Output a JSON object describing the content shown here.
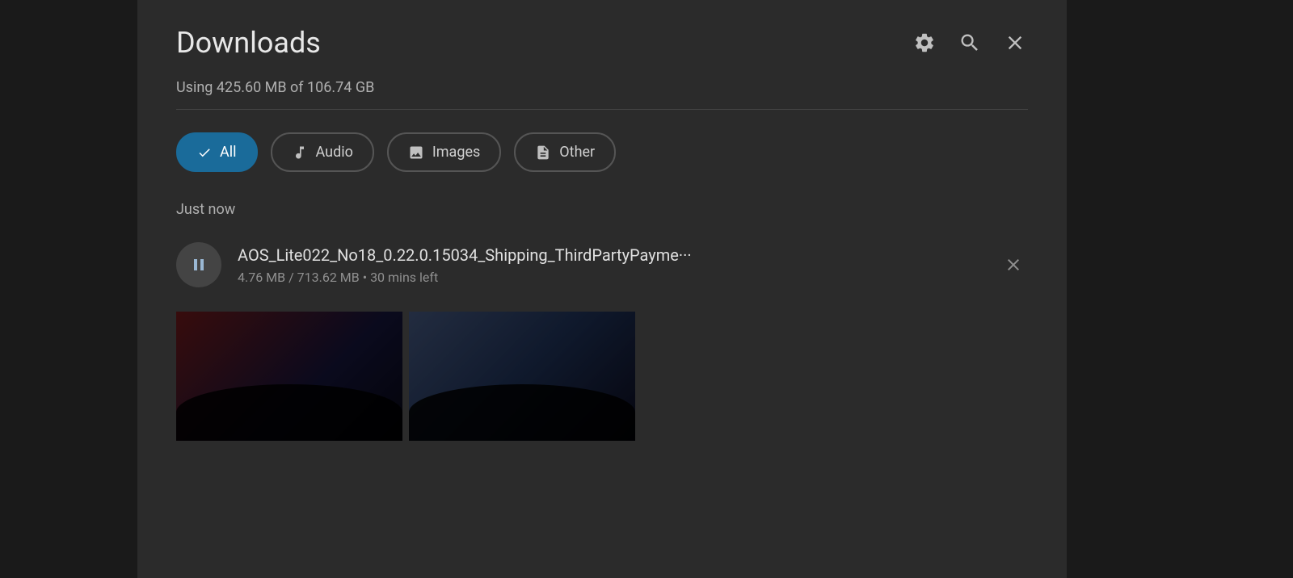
{
  "header": {
    "title": "Downloads",
    "settings_icon": "gear",
    "search_icon": "search",
    "close_icon": "close"
  },
  "storage": {
    "label": "Using 425.60 MB of 106.74 GB"
  },
  "filters": [
    {
      "id": "all",
      "label": "All",
      "icon": "check",
      "active": true
    },
    {
      "id": "audio",
      "label": "Audio",
      "icon": "music-note",
      "active": false
    },
    {
      "id": "images",
      "label": "Images",
      "icon": "image",
      "active": false
    },
    {
      "id": "other",
      "label": "Other",
      "icon": "document",
      "active": false
    }
  ],
  "section": {
    "label": "Just now"
  },
  "download_item": {
    "filename": "AOS_Lite022_No18_0.22.0.15034_Shipping_ThirdPartyPayme···",
    "progress": "4.76 MB / 713.62 MB • 30 mins left",
    "close_label": "×"
  }
}
